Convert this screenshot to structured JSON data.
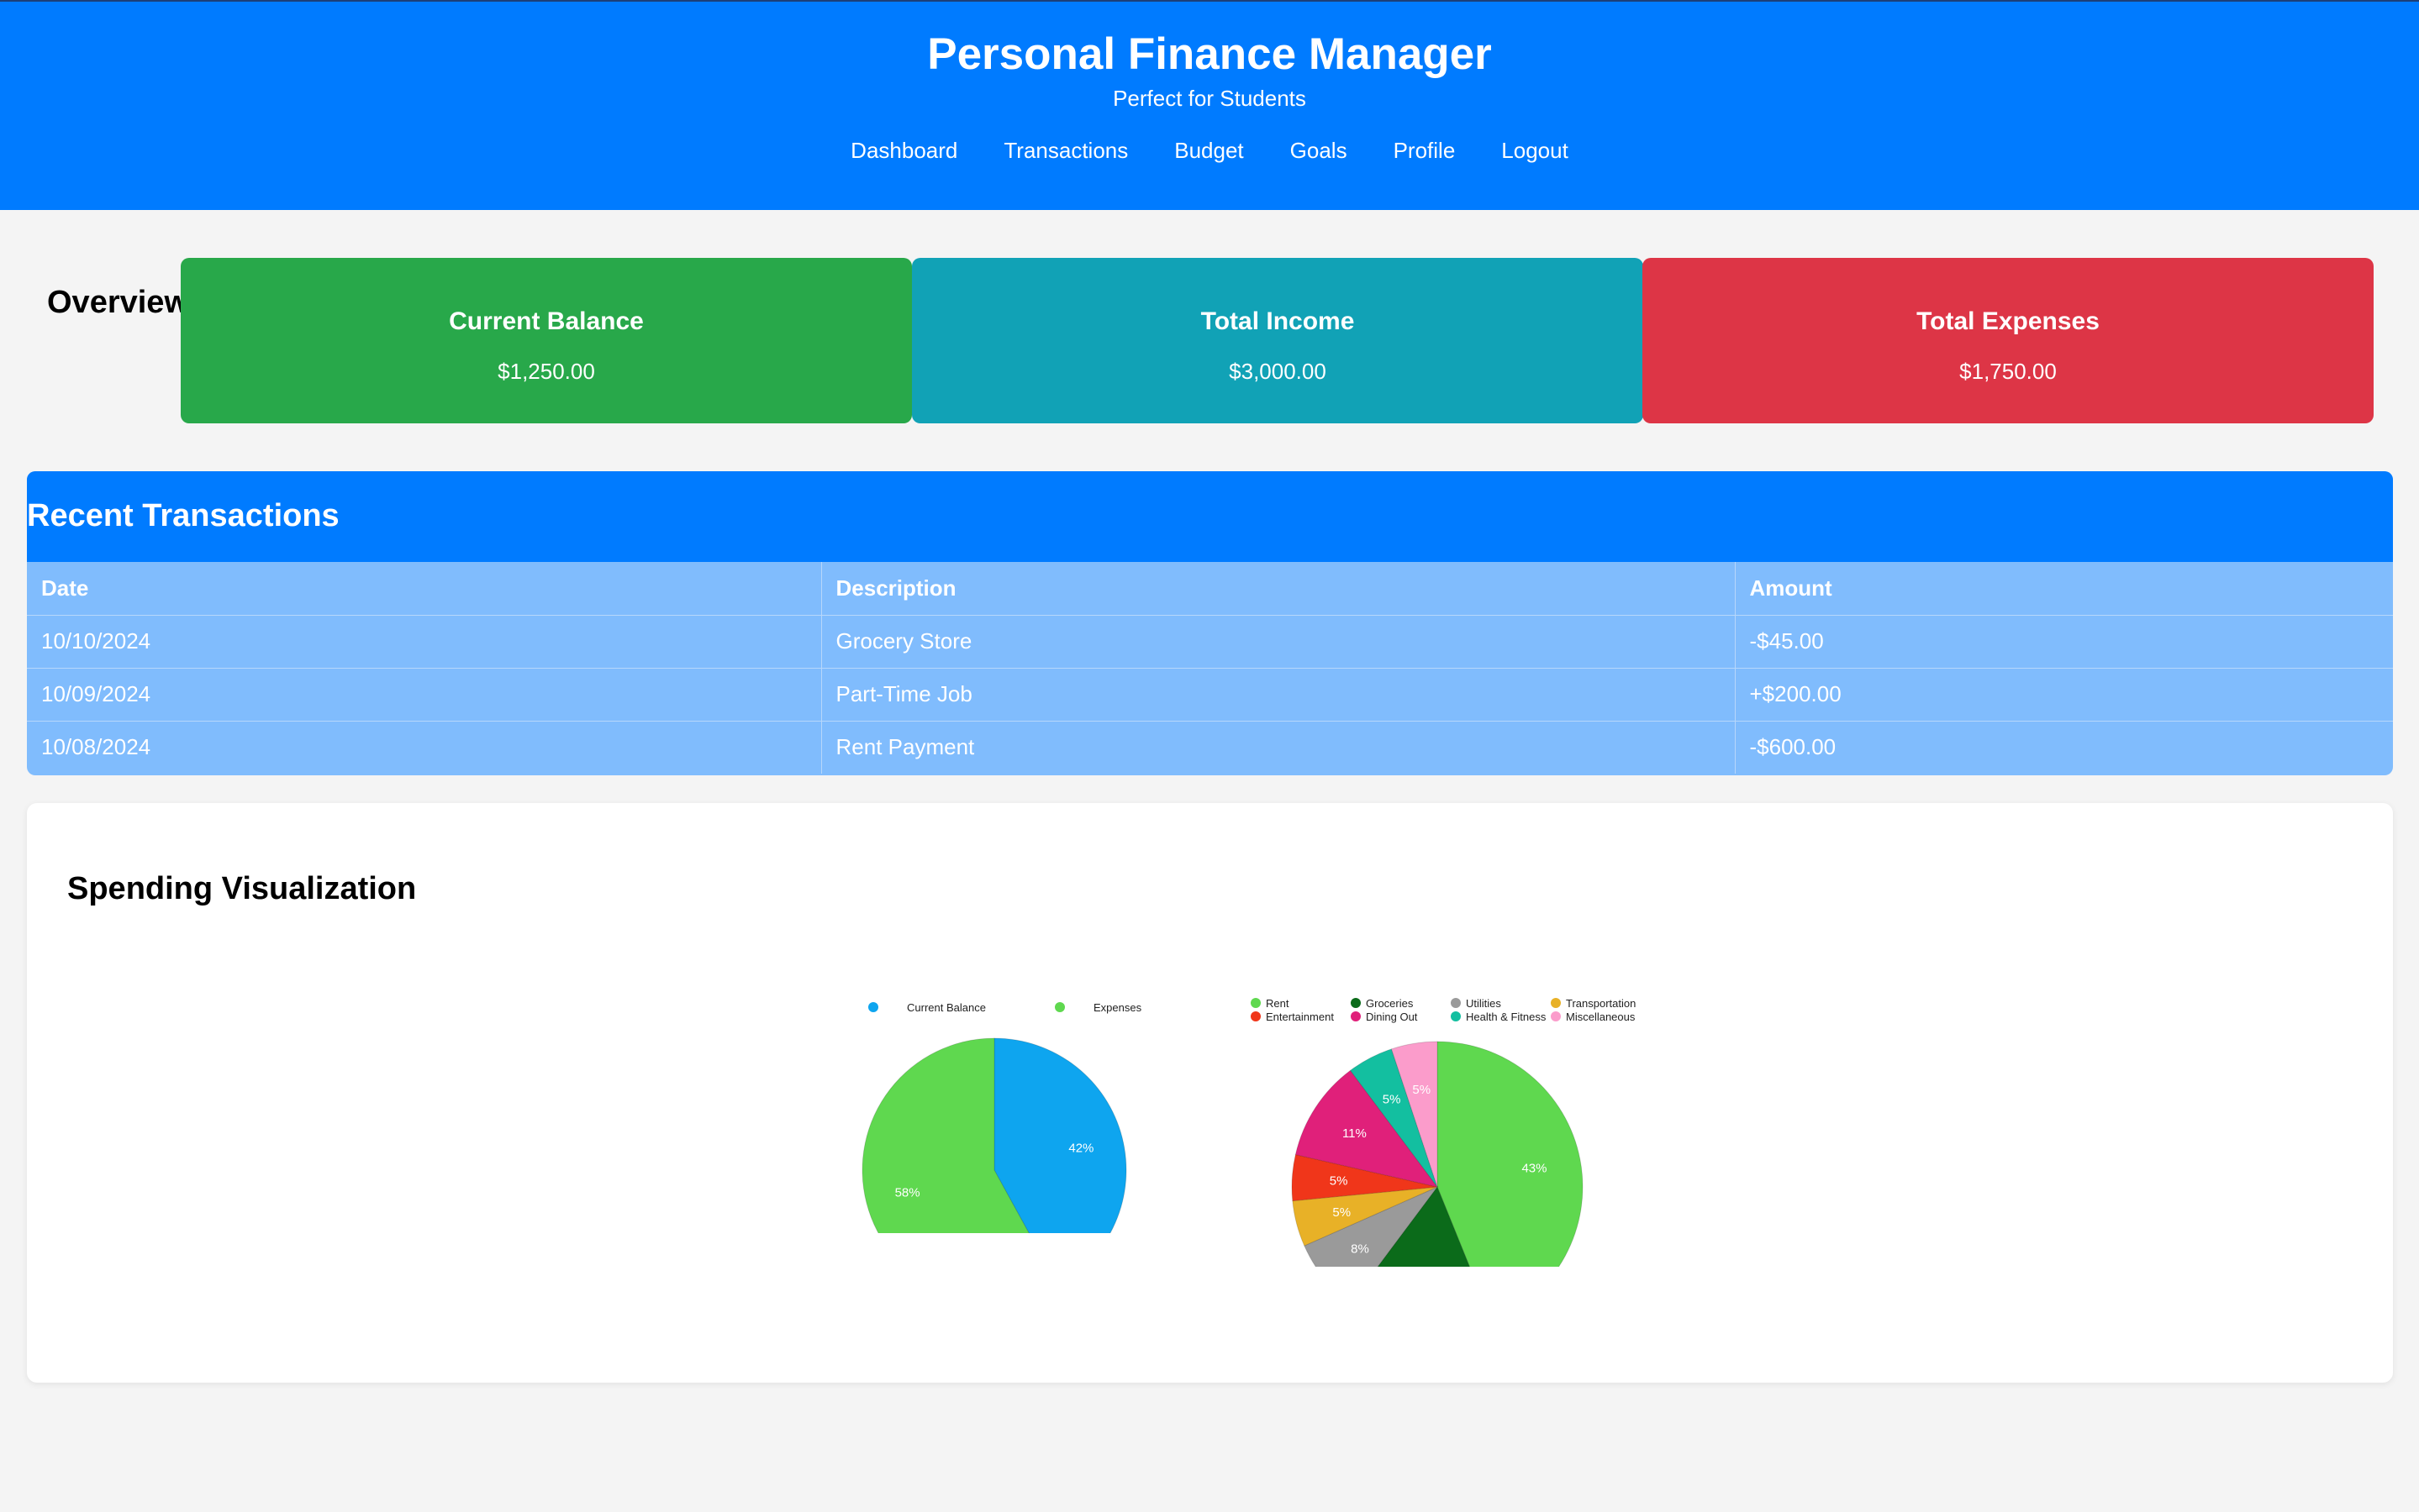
{
  "header": {
    "title": "Personal Finance Manager",
    "subtitle": "Perfect for Students",
    "nav": [
      {
        "label": "Dashboard"
      },
      {
        "label": "Transactions"
      },
      {
        "label": "Budget"
      },
      {
        "label": "Goals"
      },
      {
        "label": "Profile"
      },
      {
        "label": "Logout"
      }
    ]
  },
  "overview": {
    "title": "Overview",
    "cards": [
      {
        "label": "Current Balance",
        "value": "$1,250.00",
        "color": "#28a84a"
      },
      {
        "label": "Total Income",
        "value": "$3,000.00",
        "color": "#11a2b6"
      },
      {
        "label": "Total Expenses",
        "value": "$1,750.00",
        "color": "#dd3546"
      }
    ]
  },
  "transactions": {
    "title": "Recent Transactions",
    "columns": [
      "Date",
      "Description",
      "Amount"
    ],
    "rows": [
      [
        "10/10/2024",
        "Grocery Store",
        "-$45.00"
      ],
      [
        "10/09/2024",
        "Part-Time Job",
        "+$200.00"
      ],
      [
        "10/08/2024",
        "Rent Payment",
        "-$600.00"
      ]
    ]
  },
  "visualization": {
    "title": "Spending Visualization"
  },
  "chart_data": [
    {
      "type": "pie",
      "series": [
        {
          "name": "Current Balance",
          "value": 42,
          "label": "42%",
          "color": "#0ea5ef"
        },
        {
          "name": "Expenses",
          "value": 58,
          "label": "58%",
          "color": "#5fd84f"
        }
      ],
      "legend": "top"
    },
    {
      "type": "pie",
      "series": [
        {
          "name": "Rent",
          "value": 43,
          "label": "43%",
          "color": "#5fd84f"
        },
        {
          "name": "Groceries",
          "value": 16,
          "label": "16%",
          "color": "#0b6b1a"
        },
        {
          "name": "Utilities",
          "value": 8,
          "label": "8%",
          "color": "#9a9a9a"
        },
        {
          "name": "Transportation",
          "value": 5,
          "label": "5%",
          "color": "#e8b127"
        },
        {
          "name": "Entertainment",
          "value": 5,
          "label": "5%",
          "color": "#f0361a"
        },
        {
          "name": "Dining Out",
          "value": 11,
          "label": "11%",
          "color": "#e0207a"
        },
        {
          "name": "Health & Fitness",
          "value": 5,
          "label": "5%",
          "color": "#13bfa0"
        },
        {
          "name": "Miscellaneous",
          "value": 5,
          "label": "5%",
          "color": "#fb9ccb"
        }
      ],
      "legend": "top"
    }
  ]
}
